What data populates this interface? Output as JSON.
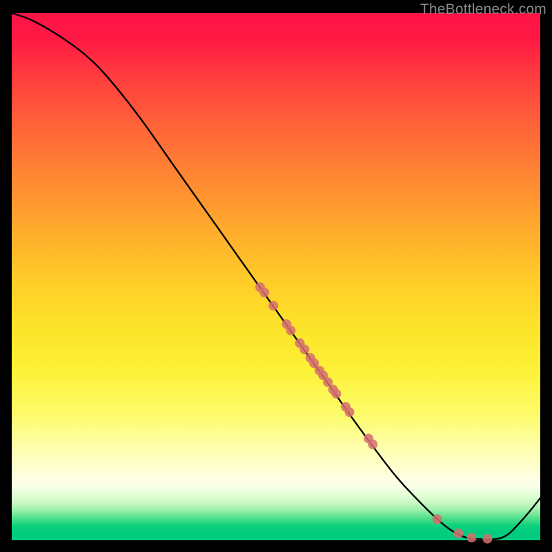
{
  "watermark": "TheBottleneck.com",
  "chart_data": {
    "type": "line",
    "title": "",
    "xlabel": "",
    "ylabel": "",
    "xlim": [
      0,
      100
    ],
    "ylim": [
      0,
      100
    ],
    "grid": false,
    "notes": "Background is a vertical rainbow heat-map (red→yellow→green). Axes have no visible tick labels; x and y normalized to 0–100. The curve depicts bottleneck percentage vs some component scale — high/red at left, reaching ~0 (ideal/green) near x≈85–92, then rising again. Red dots mark sampled hardware configurations along the curve.",
    "series": [
      {
        "name": "bottleneck_curve",
        "x": [
          0,
          3,
          6,
          10,
          14,
          18,
          24,
          30,
          36,
          42,
          48,
          54,
          60,
          66,
          72,
          76,
          80,
          83,
          86,
          89,
          92,
          94,
          96,
          98,
          100
        ],
        "y": [
          100,
          99,
          97.5,
          95,
          92,
          88,
          80.5,
          72,
          63.5,
          55,
          46.5,
          38,
          29.5,
          21,
          13,
          8.5,
          4.5,
          2,
          0.5,
          0.2,
          0.3,
          1.2,
          3.2,
          5.5,
          8
        ]
      }
    ],
    "points": {
      "name": "sampled_configs",
      "coords_note": "Each point lies on the curve; xy as fractions of plot area (0–100).",
      "xy": [
        [
          47.0,
          48.0
        ],
        [
          47.8,
          47.0
        ],
        [
          49.5,
          44.5
        ],
        [
          52.0,
          41.0
        ],
        [
          52.8,
          39.8
        ],
        [
          54.5,
          37.4
        ],
        [
          55.4,
          36.2
        ],
        [
          56.5,
          34.6
        ],
        [
          57.2,
          33.6
        ],
        [
          58.2,
          32.2
        ],
        [
          58.9,
          31.3
        ],
        [
          59.8,
          30.0
        ],
        [
          60.8,
          28.6
        ],
        [
          61.4,
          27.8
        ],
        [
          63.2,
          25.3
        ],
        [
          63.9,
          24.3
        ],
        [
          67.5,
          19.3
        ],
        [
          68.3,
          18.2
        ],
        [
          80.5,
          4.0
        ],
        [
          84.5,
          1.3
        ],
        [
          87.0,
          0.5
        ],
        [
          90.0,
          0.3
        ]
      ]
    }
  }
}
